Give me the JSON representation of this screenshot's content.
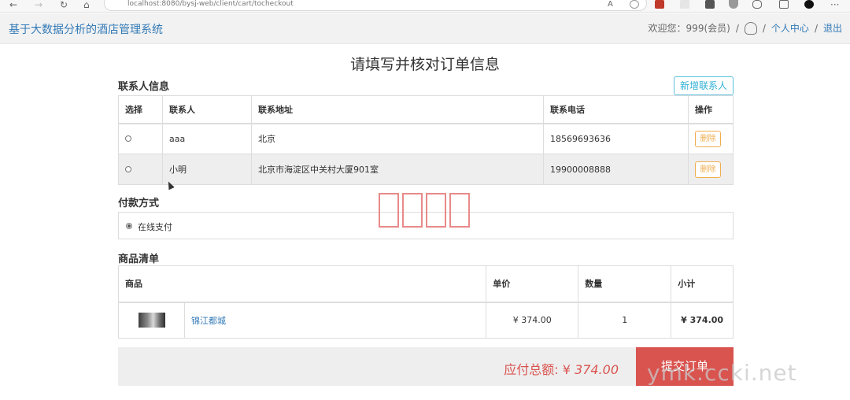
{
  "browser": {
    "url": "localhost:8080/bysj-web/client/cart/tocheckout",
    "nav_back": "←",
    "nav_forward": "→",
    "nav_refresh": "↻",
    "nav_home": "⌂",
    "font_icon": "A",
    "more_icon": "···"
  },
  "header": {
    "site_title": "基于大数据分析的酒店管理系统",
    "welcome": "欢迎您：999(会员)",
    "sep1": "/",
    "sep2": "/",
    "sep3": "/",
    "personal_center": "个人中心",
    "logout": "退出"
  },
  "page": {
    "title": "请填写并核对订单信息"
  },
  "contacts": {
    "section_title": "联系人信息",
    "add_button": "新增联系人",
    "columns": [
      "选择",
      "联系人",
      "联系地址",
      "联系电话",
      "操作"
    ],
    "rows": [
      {
        "name": "aaa",
        "address": "北京",
        "phone": "18569693636",
        "action": "删除"
      },
      {
        "name": "小明",
        "address": "北京市海淀区中关村大厦901室",
        "phone": "19900008888",
        "action": "删除"
      }
    ]
  },
  "payment": {
    "section_title": "付款方式",
    "option": "在线支付"
  },
  "goods": {
    "section_title": "商品清单",
    "columns": [
      "商品",
      "单价",
      "数量",
      "小计"
    ],
    "rows": [
      {
        "name": "锦江都城",
        "price": "¥ 374.00",
        "quantity": "1",
        "subtotal": "¥ 374.00"
      }
    ]
  },
  "summary": {
    "label": "应付总额: ¥ ",
    "amount": "374.00",
    "submit": "提交订单"
  },
  "watermark": "ymk.ccki.net",
  "colors": {
    "primary": "#337ab7",
    "danger": "#d9534f",
    "warning": "#f0ad4e",
    "info": "#5bc0de"
  }
}
